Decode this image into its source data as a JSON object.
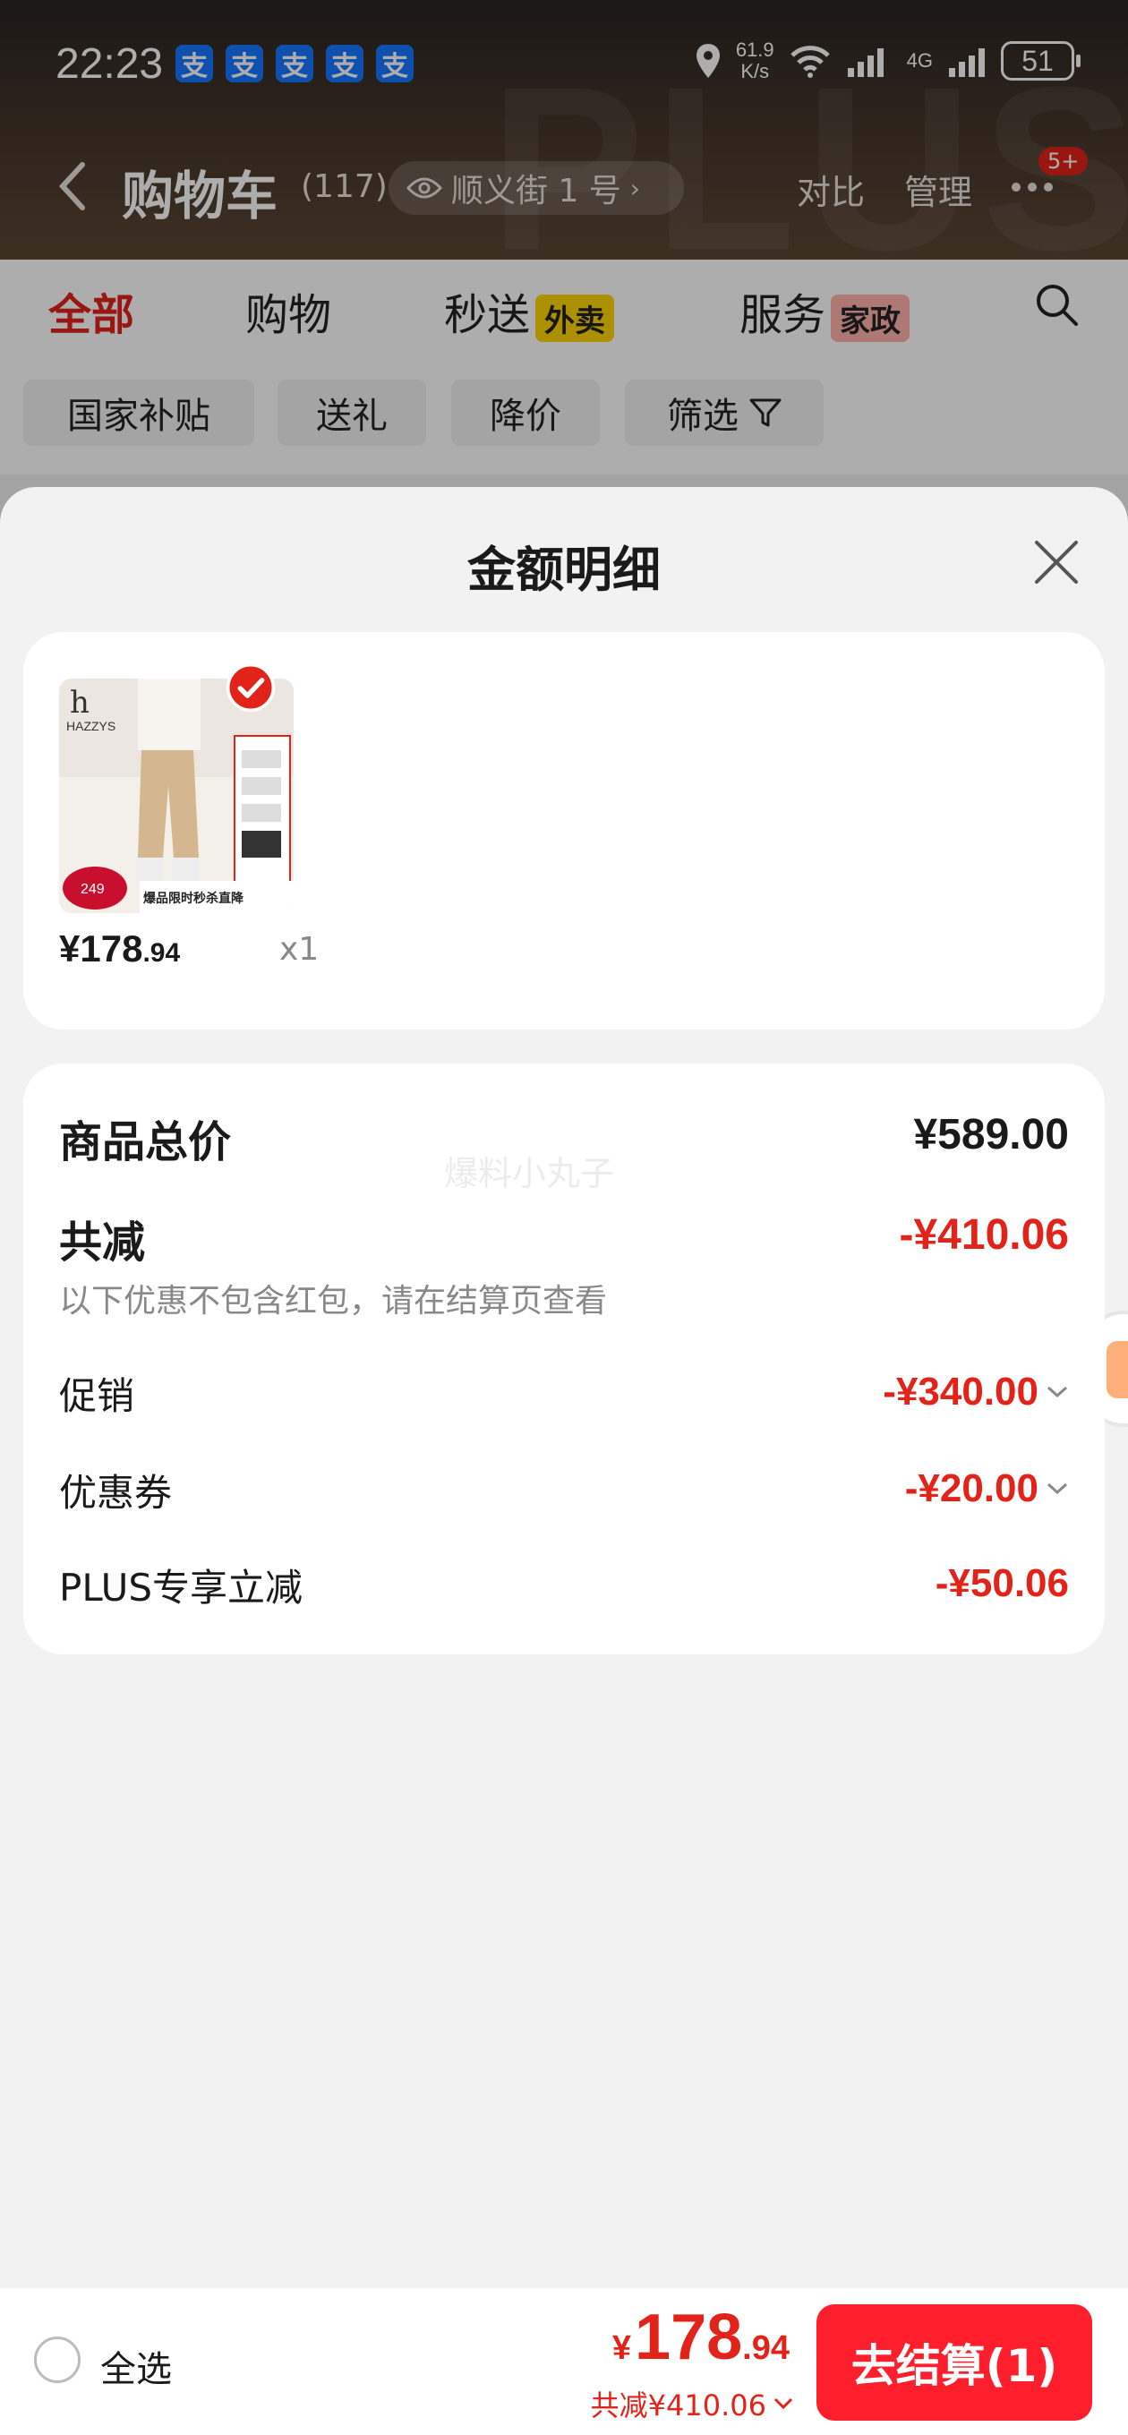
{
  "status_bar": {
    "time": "22:23",
    "app_badges": [
      "支",
      "支",
      "支",
      "支",
      "支"
    ],
    "net_speed_value": "61.9",
    "net_speed_unit": "K/s",
    "signal_label": "4G",
    "battery": "51"
  },
  "nav": {
    "title": "购物车",
    "count": "(117)",
    "address": "顺义街 1 号",
    "compare": "对比",
    "manage": "管理",
    "badge": "5+"
  },
  "tabs": [
    {
      "label": "全部"
    },
    {
      "label": "购物"
    },
    {
      "label": "秒送",
      "tag": "外卖"
    },
    {
      "label": "服务",
      "tag": "家政"
    }
  ],
  "filters": [
    {
      "label": "国家补贴"
    },
    {
      "label": "送礼"
    },
    {
      "label": "降价"
    },
    {
      "label": "筛选"
    }
  ],
  "sheet": {
    "title": "金额明细",
    "product": {
      "brand": "HAZZYS",
      "price_int": "¥178",
      "price_dec": ".94",
      "quantity": "x1",
      "promo_price": "249",
      "promo_banner": "爆品限时秒杀直降"
    },
    "summary": {
      "watermark": "爆料小丸子",
      "total_label": "商品总价",
      "total_value": "¥589.00",
      "discount_label": "共减",
      "discount_value": "-¥410.06",
      "discount_note": "以下优惠不包含红包，请在结算页查看",
      "rows": [
        {
          "label": "促销",
          "value": "-¥340.00"
        },
        {
          "label": "优惠券",
          "value": "-¥20.00"
        },
        {
          "label": "PLUS专享立减",
          "value": "-¥50.06"
        }
      ]
    }
  },
  "bottom_bar": {
    "select_all": "全选",
    "yen": "¥",
    "total_int": "178",
    "total_dec": ".94",
    "discount": "共减¥410.06",
    "checkout": "去结算(1)"
  },
  "colors": {
    "accent": "#e2231a",
    "checkout": "#ff1f2c",
    "header_bg": "#3a2e26"
  }
}
